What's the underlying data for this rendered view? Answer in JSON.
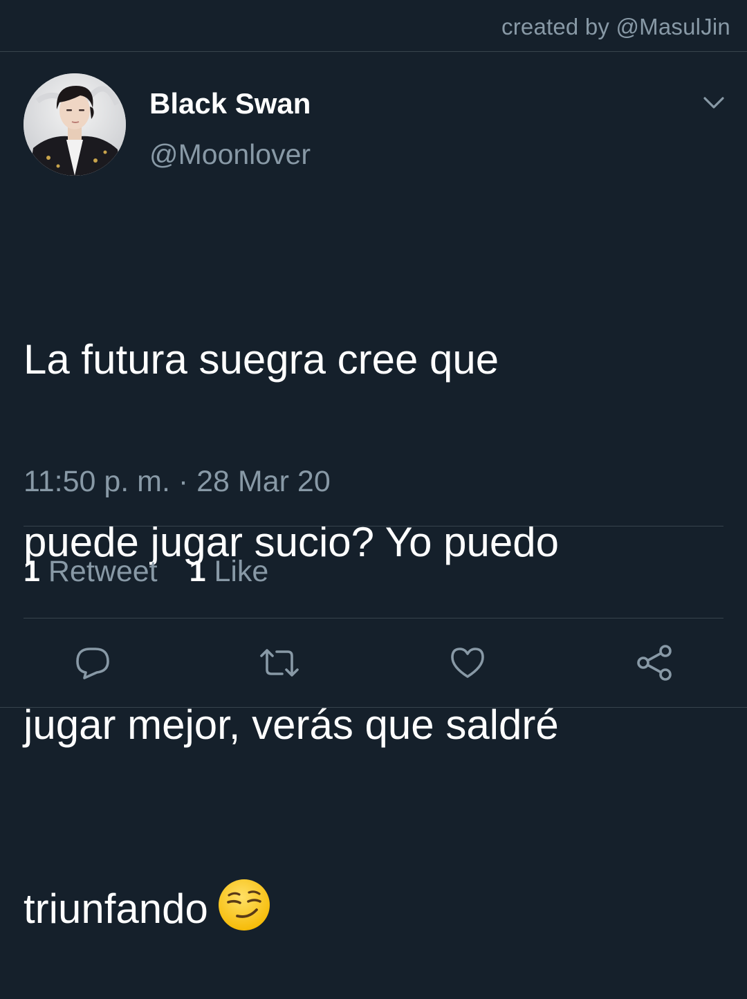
{
  "credit": "created by @MasulJin",
  "tweet": {
    "display_name": "Black Swan",
    "handle": "@Moonlover",
    "text_lines": [
      "La futura suegra cree que",
      "puede jugar sucio? Yo puedo",
      "jugar mejor, verás que saldré",
      "triunfando"
    ],
    "emoji": "😏",
    "timestamp": "11:50 p. m. · 28 Mar 20",
    "retweet_count": "1",
    "retweet_label": "Retweet",
    "like_count": "1",
    "like_label": "Like"
  },
  "icons": {
    "menu": "chevron-down-icon",
    "reply": "reply-icon",
    "retweet": "retweet-icon",
    "like": "heart-icon",
    "share": "share-icon"
  },
  "colors": {
    "background": "#15202b",
    "secondary_text": "#8899a6",
    "divider": "#38444d",
    "primary_text": "#ffffff"
  }
}
